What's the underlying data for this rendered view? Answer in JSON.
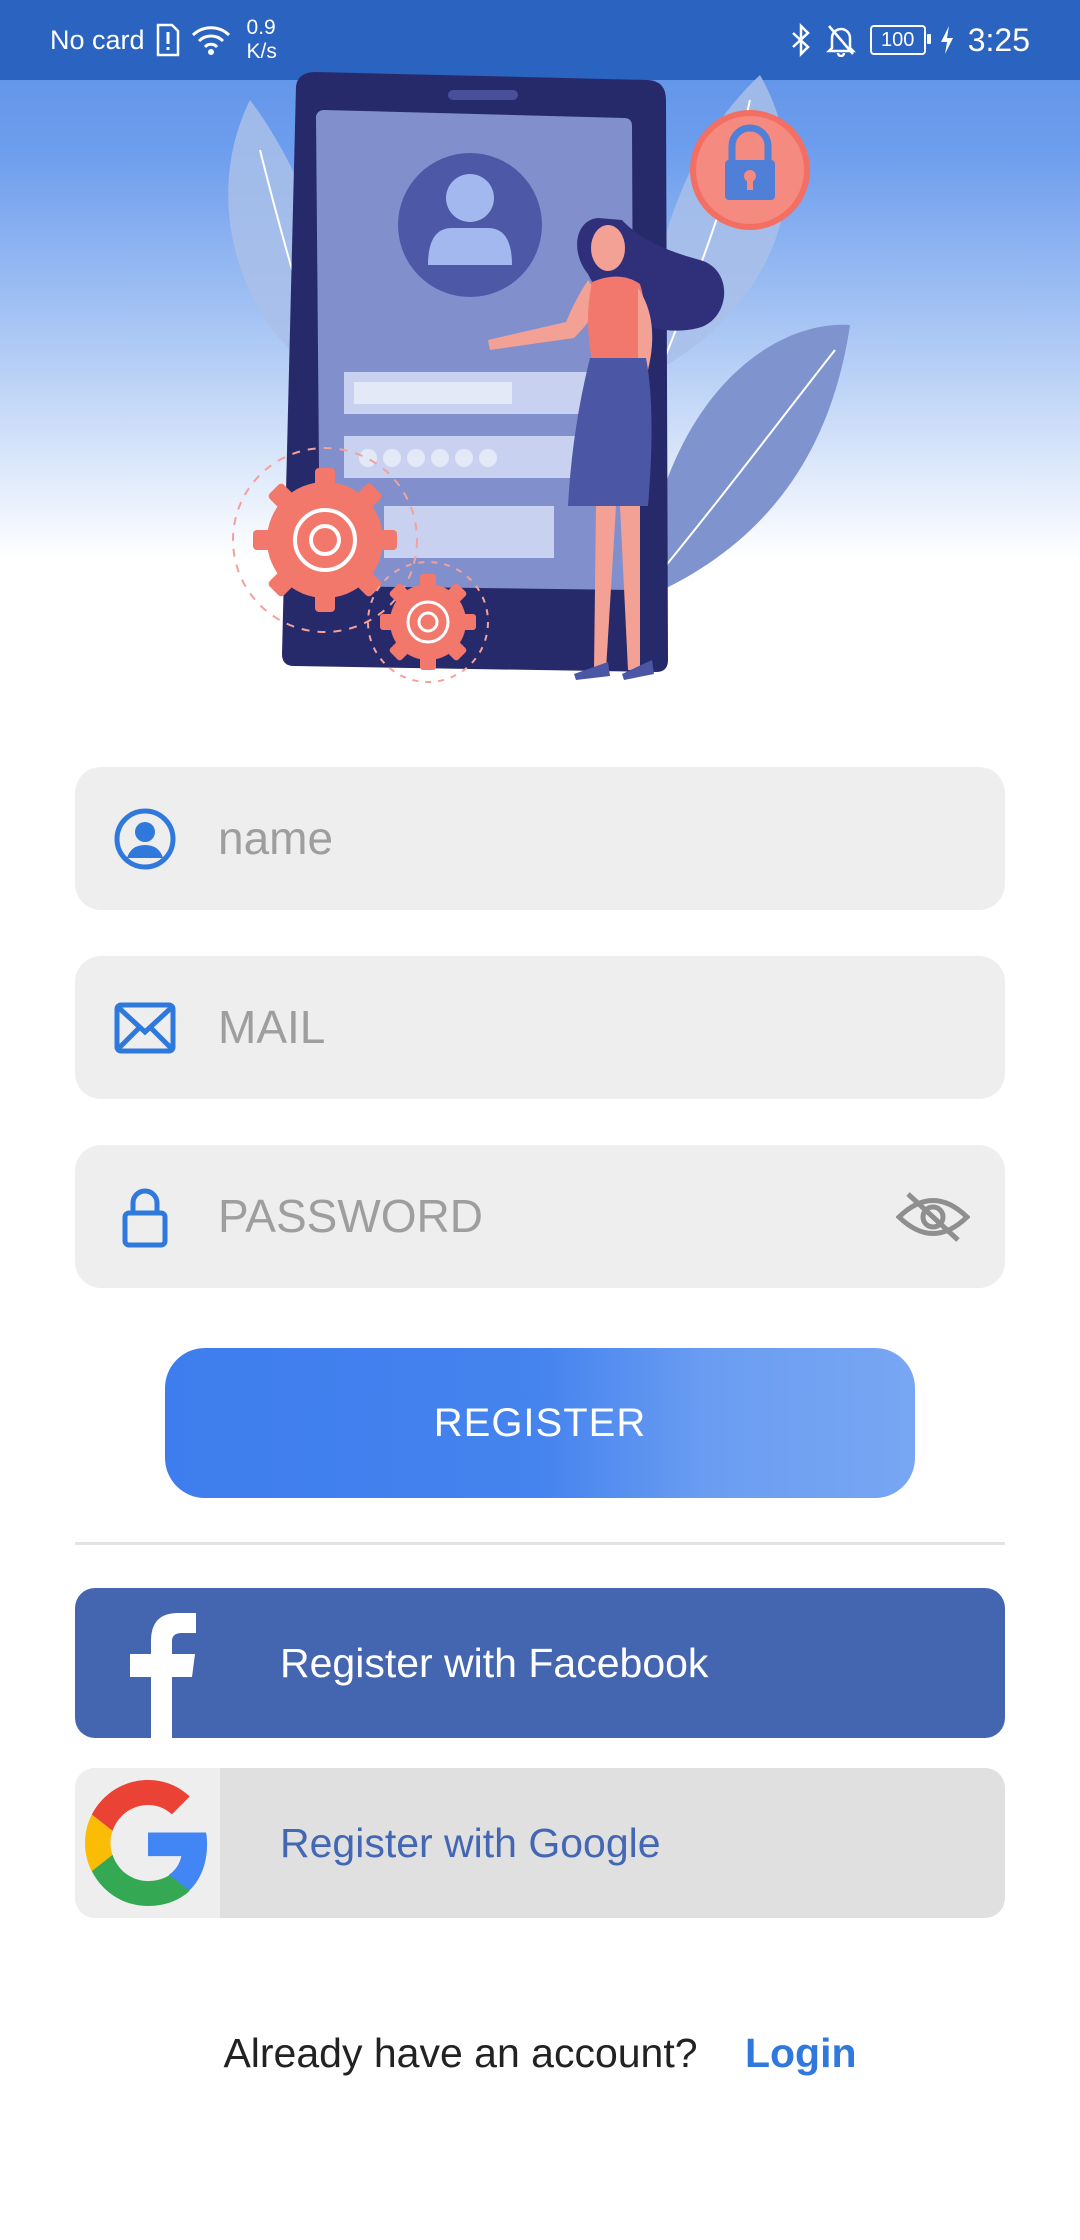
{
  "status_bar": {
    "carrier": "No card",
    "speed_value": "0.9",
    "speed_unit": "K/s",
    "battery": "100",
    "time": "3:25"
  },
  "form": {
    "name_placeholder": "name",
    "mail_placeholder": "MAIL",
    "password_placeholder": "PASSWORD"
  },
  "buttons": {
    "register": "REGISTER",
    "facebook": "Register with Facebook",
    "google": "Register with Google"
  },
  "footer": {
    "question": "Already have an account?",
    "login": "Login"
  },
  "icons": {
    "name": "user-circle-icon",
    "mail": "mail-icon",
    "password": "lock-icon",
    "visibility": "eye-off-icon",
    "facebook": "facebook-icon",
    "google": "google-icon"
  },
  "colors": {
    "accent": "#2f78dc",
    "status_bar": "#2a63c0",
    "facebook": "#4466b0",
    "field_bg": "#eeeeee",
    "placeholder": "#9e9e9e"
  }
}
